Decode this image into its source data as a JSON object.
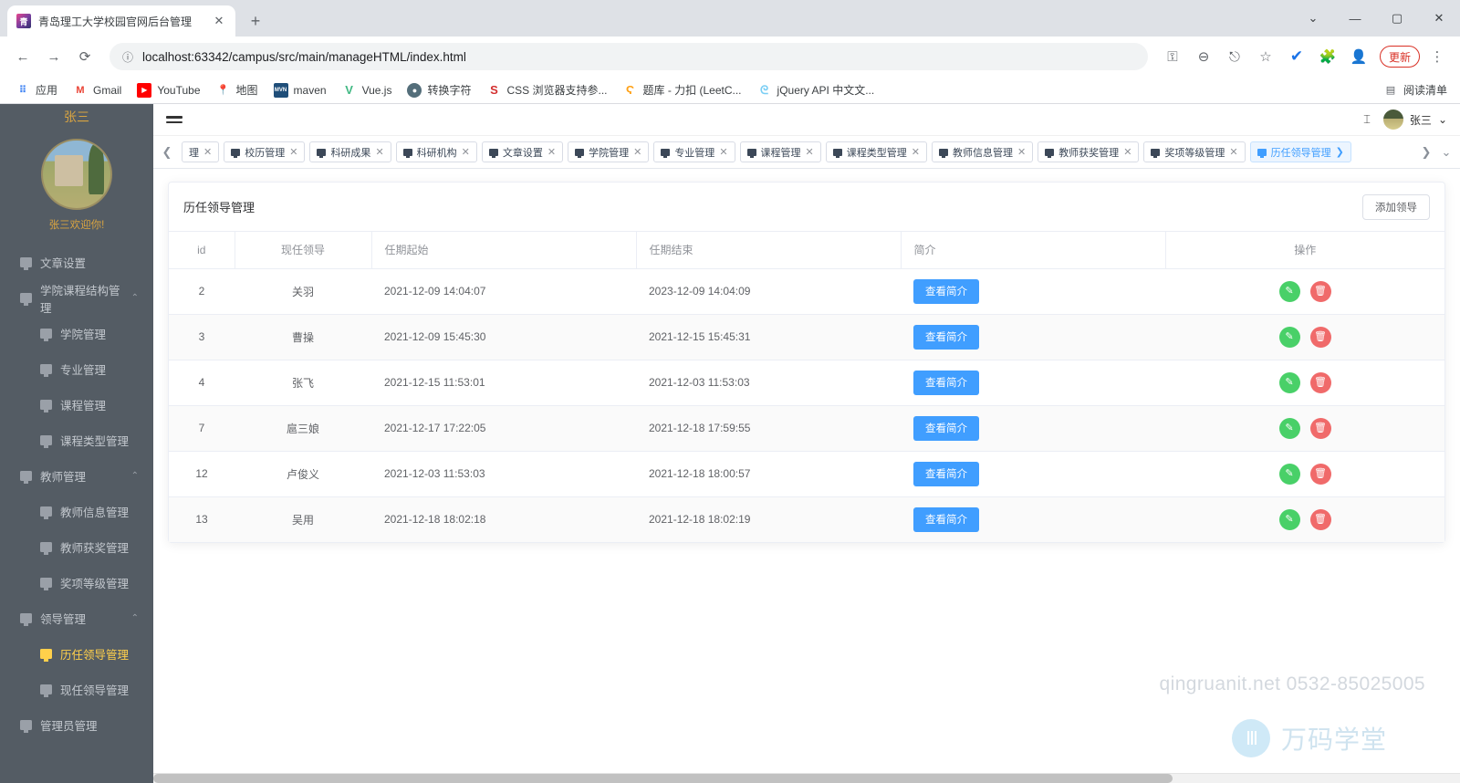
{
  "browser": {
    "tab_title": "青岛理工大学校园官网后台管理",
    "tab_close": "✕",
    "new_tab": "+",
    "favicon_letter": "青",
    "nav": {
      "back": "←",
      "forward": "→",
      "reload": "⟳"
    },
    "url": "localhost:63342/campus/src/main/manageHTML/index.html",
    "url_info_icon": "ⓘ",
    "omni_icons": [
      "key-icon",
      "zoom-out-icon",
      "share-icon",
      "star-icon"
    ],
    "toolbar_icons": [
      "profile-check-icon",
      "extensions-icon",
      "account-icon"
    ],
    "update_label": "更新",
    "menu_icon": "⋮",
    "window_controls": {
      "chevron": "⌄",
      "minimize": "—",
      "maximize": "▢",
      "close": "✕"
    },
    "bookmarks": [
      {
        "label": "应用",
        "icon": "apps-grid-icon",
        "glyph": "⠿",
        "color": "#4285f4"
      },
      {
        "label": "Gmail",
        "icon": "gmail-icon",
        "glyph": "M",
        "color": "#ea4335"
      },
      {
        "label": "YouTube",
        "icon": "youtube-icon",
        "glyph": "▶",
        "color": "#ff0000"
      },
      {
        "label": "地图",
        "icon": "maps-icon",
        "glyph": "📍",
        "color": "#34a853"
      },
      {
        "label": "maven",
        "icon": "maven-icon",
        "glyph": "MVN",
        "color": "#1f4e79"
      },
      {
        "label": "Vue.js",
        "icon": "vuejs-icon",
        "glyph": "V",
        "color": "#41b883"
      },
      {
        "label": "转换字符",
        "icon": "globe-icon",
        "glyph": "🌐",
        "color": "#546e7a"
      },
      {
        "label": "CSS 浏览器支持参...",
        "icon": "css-support-icon",
        "glyph": "S",
        "color": "#d32f2f"
      },
      {
        "label": "题库 - 力扣 (LeetC...",
        "icon": "leetcode-icon",
        "glyph": "C",
        "color": "#ffa116"
      },
      {
        "label": "jQuery API 中文文...",
        "icon": "jquery-icon",
        "glyph": "J",
        "color": "#7acef4"
      }
    ],
    "reading_list": {
      "label": "阅读清单",
      "icon": "reading-list-icon",
      "glyph": "▤"
    }
  },
  "sidebar": {
    "user_name": "张三",
    "welcome": "张三欢迎你!",
    "avatar_icon": "user-avatar",
    "items": [
      {
        "label": "文章设置",
        "level": 1,
        "active": false,
        "caret": ""
      },
      {
        "label": "学院课程结构管理",
        "level": 1,
        "active": false,
        "caret": "⌃"
      },
      {
        "label": "学院管理",
        "level": 2,
        "active": false,
        "caret": ""
      },
      {
        "label": "专业管理",
        "level": 2,
        "active": false,
        "caret": ""
      },
      {
        "label": "课程管理",
        "level": 2,
        "active": false,
        "caret": ""
      },
      {
        "label": "课程类型管理",
        "level": 2,
        "active": false,
        "caret": ""
      },
      {
        "label": "教师管理",
        "level": 1,
        "active": false,
        "caret": "⌃"
      },
      {
        "label": "教师信息管理",
        "level": 2,
        "active": false,
        "caret": ""
      },
      {
        "label": "教师获奖管理",
        "level": 2,
        "active": false,
        "caret": ""
      },
      {
        "label": "奖项等级管理",
        "level": 2,
        "active": false,
        "caret": ""
      },
      {
        "label": "领导管理",
        "level": 1,
        "active": false,
        "caret": "⌃"
      },
      {
        "label": "历任领导管理",
        "level": 2,
        "active": true,
        "caret": ""
      },
      {
        "label": "现任领导管理",
        "level": 2,
        "active": false,
        "caret": ""
      },
      {
        "label": "管理员管理",
        "level": 1,
        "active": false,
        "caret": ""
      }
    ]
  },
  "topbar": {
    "collapse_icon": "menu-collapse-icon",
    "pin_icon": "⌶",
    "user_label": "张三",
    "chevron": "⌄"
  },
  "apptabs": {
    "prev_arrow": "❮",
    "next_arrow": "❯",
    "more_arrow": "⌄",
    "items": [
      {
        "label": "理",
        "active": false,
        "close": "✕"
      },
      {
        "label": "校历管理",
        "active": false,
        "close": "✕"
      },
      {
        "label": "科研成果",
        "active": false,
        "close": "✕"
      },
      {
        "label": "科研机构",
        "active": false,
        "close": "✕"
      },
      {
        "label": "文章设置",
        "active": false,
        "close": "✕"
      },
      {
        "label": "学院管理",
        "active": false,
        "close": "✕"
      },
      {
        "label": "专业管理",
        "active": false,
        "close": "✕"
      },
      {
        "label": "课程管理",
        "active": false,
        "close": "✕"
      },
      {
        "label": "课程类型管理",
        "active": false,
        "close": "✕"
      },
      {
        "label": "教师信息管理",
        "active": false,
        "close": "✕"
      },
      {
        "label": "教师获奖管理",
        "active": false,
        "close": "✕"
      },
      {
        "label": "奖项等级管理",
        "active": false,
        "close": "✕"
      },
      {
        "label": "历任领导管理",
        "active": true,
        "close": "❯"
      }
    ]
  },
  "page": {
    "title": "历任领导管理",
    "add_button": "添加领导",
    "columns": [
      "id",
      "现任领导",
      "任期起始",
      "任期结束",
      "简介",
      "操作"
    ],
    "view_button_label": "查看简介",
    "edit_icon": "pencil-icon",
    "delete_icon": "trash-icon",
    "edit_glyph": "✎",
    "delete_glyph": "🗑",
    "rows": [
      {
        "id": "2",
        "leader": "关羽",
        "start": "2021-12-09 14:04:07",
        "end": "2023-12-09 14:04:09"
      },
      {
        "id": "3",
        "leader": "曹操",
        "start": "2021-12-09 15:45:30",
        "end": "2021-12-15 15:45:31"
      },
      {
        "id": "4",
        "leader": "张飞",
        "start": "2021-12-15 11:53:01",
        "end": "2021-12-03 11:53:03"
      },
      {
        "id": "7",
        "leader": "扈三娘",
        "start": "2021-12-17 17:22:05",
        "end": "2021-12-18 17:59:55"
      },
      {
        "id": "12",
        "leader": "卢俊义",
        "start": "2021-12-03 11:53:03",
        "end": "2021-12-18 18:00:57"
      },
      {
        "id": "13",
        "leader": "吴用",
        "start": "2021-12-18 18:02:18",
        "end": "2021-12-18 18:02:19"
      }
    ]
  },
  "watermark": {
    "text": "qingruanit.net 0532-85025005",
    "brand": "万码学堂",
    "logo_glyph": "Ⅲ"
  },
  "colors": {
    "sidebar_bg": "#545c64",
    "accent_blue": "#409eff",
    "active_gold": "#ffd04b",
    "edit_green": "#49d068",
    "delete_red": "#f06a6a",
    "update_red": "#d93025"
  }
}
